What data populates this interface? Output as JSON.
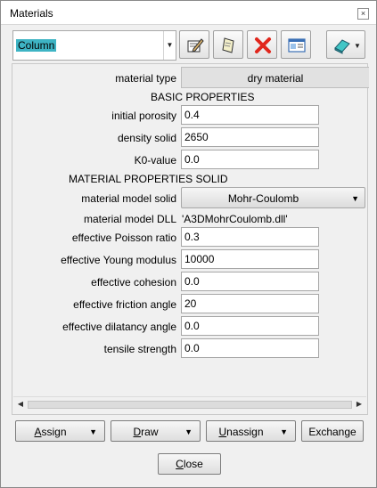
{
  "window": {
    "title": "Materials",
    "close_glyph": "×"
  },
  "toolbar": {
    "material_selector": {
      "value": "Column"
    },
    "icons": [
      "edit-icon",
      "copy-icon",
      "delete-icon",
      "window-icon",
      "eraser-icon"
    ]
  },
  "properties": {
    "material_type_label": "material type",
    "material_type_value": "dry material",
    "basic_header": "BASIC PROPERTIES",
    "initial_porosity_label": "initial porosity",
    "initial_porosity_value": "0.4",
    "density_solid_label": "density solid",
    "density_solid_value": "2650",
    "k0_label": "K0-value",
    "k0_value": "0.0",
    "solid_header": "MATERIAL PROPERTIES SOLID",
    "material_model_solid_label": "material model solid",
    "material_model_solid_value": "Mohr-Coulomb",
    "material_model_dll_label": "material model DLL",
    "material_model_dll_value": "'A3DMohrCoulomb.dll'",
    "poisson_label": "effective Poisson ratio",
    "poisson_value": "0.3",
    "young_label": "effective Young modulus",
    "young_value": "10000",
    "cohesion_label": "effective cohesion",
    "cohesion_value": "0.0",
    "friction_label": "effective friction angle",
    "friction_value": "20",
    "dilatancy_label": "effective dilatancy angle",
    "dilatancy_value": "0.0",
    "tensile_label": "tensile strength",
    "tensile_value": "0.0"
  },
  "scrollbar": {
    "left_glyph": "◀",
    "right_glyph": "▶"
  },
  "actions": {
    "assign_hotkey": "A",
    "assign_rest": "ssign",
    "draw_hotkey": "D",
    "draw_rest": "raw",
    "unassign_hotkey": "U",
    "unassign_rest": "nassign",
    "exchange": "Exchange",
    "close_hotkey": "C",
    "close_rest": "lose",
    "dropdown_glyph": "▼"
  }
}
